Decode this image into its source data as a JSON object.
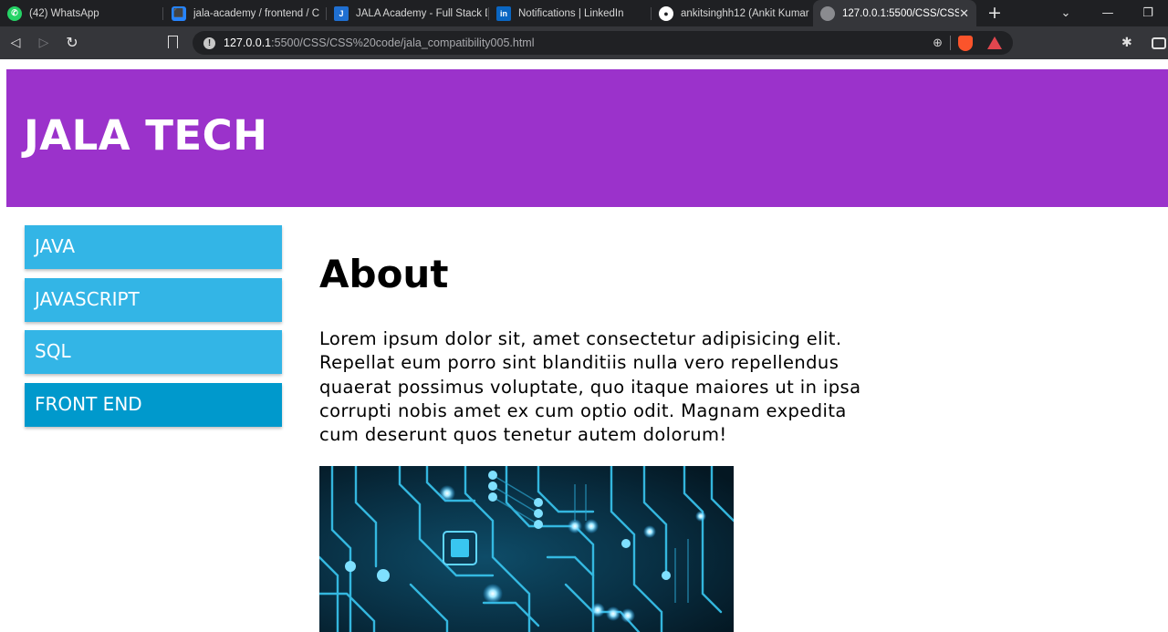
{
  "browser": {
    "tabs": [
      {
        "title": "(42) WhatsApp",
        "icon": "whatsapp-icon"
      },
      {
        "title": "jala-academy / frontend / C",
        "icon": "bitbucket-icon"
      },
      {
        "title": "JALA Academy - Full Stack D",
        "icon": "jala-icon"
      },
      {
        "title": "Notifications | LinkedIn",
        "icon": "linkedin-icon"
      },
      {
        "title": "ankitsinghh12 (Ankit Kumar",
        "icon": "github-icon"
      },
      {
        "title": "127.0.0.1:5500/CSS/CSS",
        "icon": "globe-icon",
        "active": true
      }
    ],
    "url_host": "127.0.0.1",
    "url_rest": ":5500/CSS/CSS%20code/jala_compatibility005.html"
  },
  "site": {
    "brand": "JALA TECH",
    "menu": [
      {
        "label": "JAVA"
      },
      {
        "label": "JAVASCRIPT"
      },
      {
        "label": "SQL"
      },
      {
        "label": "FRONT END"
      }
    ],
    "about": {
      "title": "About",
      "paragraph": "Lorem ipsum dolor sit, amet consectetur adipisicing elit. Repellat eum porro sint blanditiis nulla vero repellendus quaerat possimus voluptate, quo itaque maiores ut in ipsa corrupti nobis amet ex cum optio odit. Magnam expedita cum deserunt quos tenetur autem dolorum!"
    }
  },
  "colors": {
    "header_bg": "#9b32cb",
    "menu_bg": "#33b5e6",
    "menu_active_bg": "#0099cc"
  }
}
